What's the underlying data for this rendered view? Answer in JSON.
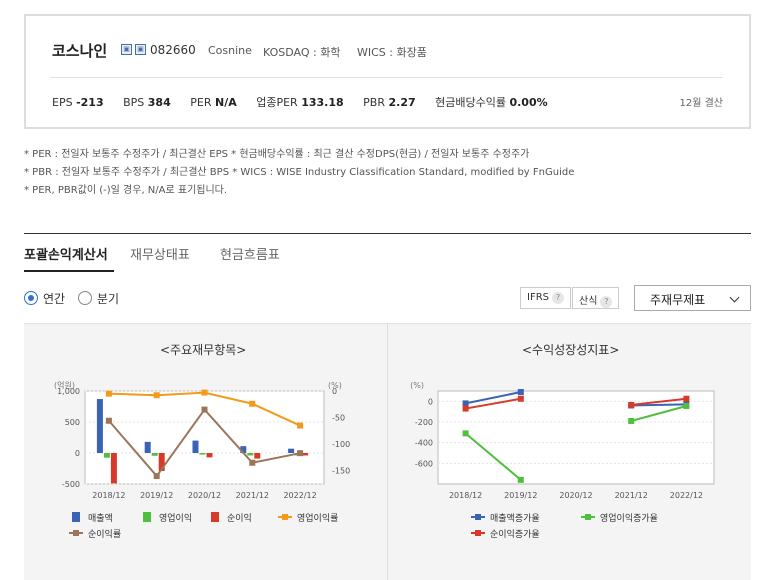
{
  "company": {
    "name": "코스나인",
    "code": "082660",
    "eng_name": "Cosnine",
    "market": "KOSDAQ : 화학",
    "wics": "WICS : 화장품",
    "icons": [
      "building-icon",
      "building-alt-icon"
    ]
  },
  "metrics": {
    "eps_label": "EPS",
    "eps_value": "-213",
    "bps_label": "BPS",
    "bps_value": "384",
    "per_label": "PER",
    "per_value": "N/A",
    "sector_per_label": "업종PER",
    "sector_per_value": "133.18",
    "pbr_label": "PBR",
    "pbr_value": "2.27",
    "dividend_label": "현금배당수익률",
    "dividend_value": "0.00%",
    "fiscal": "12월 결산"
  },
  "notes": [
    "* PER : 전일자 보통주 수정주가 / 최근결산 EPS * 현금배당수익률 : 최근 결산 수정DPS(현금) / 전일자 보통주 수정주가",
    "* PBR : 전일자 보통주 수정주가 / 최근결산 BPS * WICS : WISE Industry Classification Standard, modified by FnGuide",
    "* PER, PBR값이 (-)일 경우, N/A로 표기됩니다."
  ],
  "tabs": [
    "포괄손익계산서",
    "재무상태표",
    "현금흐름표"
  ],
  "period": {
    "annual": "연간",
    "quarter": "분기",
    "selected": "annual"
  },
  "buttons": {
    "ifrs": "IFRS",
    "calc": "산식",
    "select_value": "주재무제표"
  },
  "colors": {
    "revenue": "#3a63b5",
    "op_income": "#4fbf3e",
    "net_income": "#d8392b",
    "op_margin": "#f39a1a",
    "net_margin": "#9b7559",
    "growth_revenue": "#3a63b5",
    "growth_op": "#4fbf3e",
    "growth_net": "#d8392b"
  },
  "chart_data": [
    {
      "type": "bar",
      "title": "<주요재무항목>",
      "ylabel": "(억원)",
      "y2label": "(%)",
      "categories": [
        "2018/12",
        "2019/12",
        "2020/12",
        "2021/12",
        "2022/12"
      ],
      "ylim": [
        -500,
        1000
      ],
      "yticks": [
        "1,000",
        "500",
        "0",
        "-500"
      ],
      "ytick_values": [
        1000,
        500,
        0,
        -500
      ],
      "y2lim": [
        -175,
        0
      ],
      "y2ticks": [
        "0",
        "-50",
        "-100",
        "-150"
      ],
      "y2tick_values": [
        0,
        -50,
        -100,
        -150
      ],
      "series": [
        {
          "name": "매출액",
          "kind": "bar",
          "values": [
            870,
            180,
            200,
            110,
            70
          ]
        },
        {
          "name": "영업이익",
          "kind": "bar",
          "values": [
            -75,
            -45,
            -25,
            -40,
            -40
          ]
        },
        {
          "name": "순이익",
          "kind": "bar",
          "values": [
            -490,
            -290,
            -70,
            -90,
            -40
          ]
        },
        {
          "name": "영업이익률",
          "kind": "line",
          "values": [
            -5,
            -8,
            -3,
            -24,
            -65
          ]
        },
        {
          "name": "순이익률",
          "kind": "line",
          "values": [
            -56,
            -160,
            -35,
            -135,
            -117
          ]
        }
      ],
      "legend": "bottom"
    },
    {
      "type": "line",
      "title": "<수익성장성지표>",
      "ylabel": "(%)",
      "categories": [
        "2018/12",
        "2019/12",
        "2020/12",
        "2021/12",
        "2022/12"
      ],
      "ylim": [
        -800,
        100
      ],
      "yticks": [
        "0",
        "-200",
        "-400",
        "-600"
      ],
      "ytick_values": [
        0,
        -200,
        -400,
        -600
      ],
      "series": [
        {
          "name": "매출액증가율",
          "values": [
            -20,
            90,
            null,
            -40,
            -30
          ]
        },
        {
          "name": "영업이익증가율",
          "values": [
            -310,
            -760,
            null,
            -190,
            -45
          ]
        },
        {
          "name": "순이익증가율",
          "values": [
            -70,
            25,
            null,
            -35,
            25
          ]
        }
      ],
      "legend": "bottom"
    }
  ]
}
